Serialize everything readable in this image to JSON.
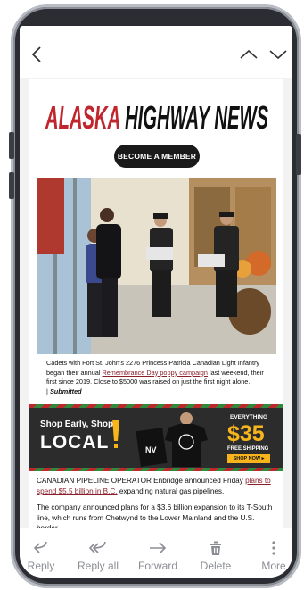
{
  "newsletter": {
    "logo_text": "ALASKA HIGHWAY NEWS",
    "member_button": "BECOME A MEMBER",
    "caption": {
      "text_before_link": "Cadets with Fort St. John's 2276 Princess Patricia Canadian Light Infantry began their annual ",
      "link_text": "Remembrance Day poppy campaign",
      "text_after_link": " last weekend, their first since 2019. Close to $5000 was raised on just the first night alone.",
      "credit_prefix": "| ",
      "credit": "Submitted"
    },
    "ad": {
      "line1": "Shop Early, Shop",
      "line2": "LOCAL",
      "everything": "EVERYTHING",
      "price": "$35",
      "shipping": "FREE SHIPPING",
      "cta": "SHOP NOW ▸",
      "shirt_brand": "NV"
    },
    "article": {
      "p1_before": "CANADIAN PIPELINE OPERATOR Enbridge announced Friday ",
      "p1_link": "plans to spend $5.5 billion in B.C.",
      "p1_after": " expanding natural gas pipelines.",
      "p2": "The company announced plans for a $3.6 billion expansion to its T-South line, which runs from Chetwynd to the Lower Mainland and the U.S. border."
    }
  },
  "actions": [
    {
      "label": "Reply",
      "icon": "reply-icon"
    },
    {
      "label": "Reply all",
      "icon": "reply-all-icon"
    },
    {
      "label": "Forward",
      "icon": "forward-icon"
    },
    {
      "label": "Delete",
      "icon": "trash-icon"
    },
    {
      "label": "More",
      "icon": "more-vertical-icon"
    }
  ],
  "colors": {
    "logo_red": "#c0262d",
    "link": "#8a1f2a",
    "ad_yellow": "#f7b51b",
    "action_gray": "#8a8d93"
  }
}
